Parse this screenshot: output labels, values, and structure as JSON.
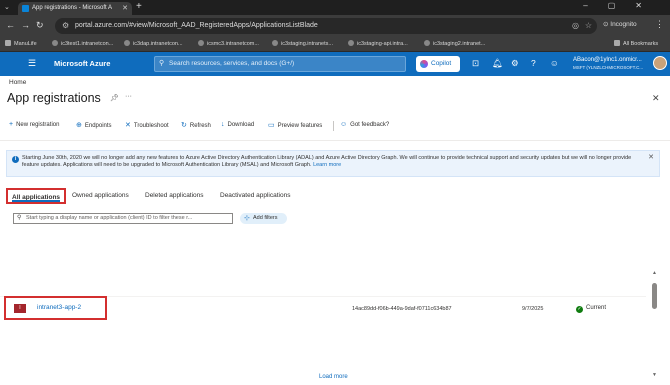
{
  "browser": {
    "tab_title": "App registrations - Microsoft A",
    "url": "portal.azure.com/#view/Microsoft_AAD_RegisteredApps/ApplicationsListBlade",
    "profile_label": "Incognito",
    "bookmarks": [
      "ManuLife",
      "ic3test1.intranetcon...",
      "ic3dap.intranetcon...",
      "icsmc3.intranetcom...",
      "ic3staging.intranets...",
      "ic3staging-api.intra...",
      "ic3staging2.intranet..."
    ],
    "all_bookmarks_label": "All Bookmarks"
  },
  "azure_header": {
    "brand": "Microsoft Azure",
    "search_placeholder": "Search resources, services, and docs (G+/)",
    "copilot_label": "Copilot",
    "user_email": "ABacon@1ylnc1.onmicr...",
    "user_tenant": "MSFT (YLNZLCHMICROSOFT.C..."
  },
  "page": {
    "breadcrumb": "Home",
    "title": "App registrations"
  },
  "toolbar": {
    "new_registration": "New registration",
    "endpoints": "Endpoints",
    "troubleshoot": "Troubleshoot",
    "refresh": "Refresh",
    "download": "Download",
    "preview_features": "Preview features",
    "got_feedback": "Got feedback?"
  },
  "info_banner": {
    "text": "Starting June 30th, 2020 we will no longer add any new features to Azure Active Directory Authentication Library (ADAL) and Azure Active Directory Graph. We will continue to provide technical support and security updates but we will no longer provide feature updates. Applications will need to be upgraded to Microsoft Authentication Library (MSAL) and Microsoft Graph.",
    "link": "Learn more"
  },
  "tabs": [
    "All applications",
    "Owned applications",
    "Deleted applications",
    "Deactivated applications"
  ],
  "filter": {
    "placeholder": "Start typing a display name or application (client) ID to filter these r...",
    "add_filters": "Add filters"
  },
  "apps": [
    {
      "icon_text": "I",
      "name": "intranet3-app-2",
      "client_id": "14ac89dd-f06b-449a-9daf-f0711c634b87",
      "created": "9/7/2025",
      "status": "Current"
    }
  ],
  "load_more": "Load more",
  "colors": {
    "azure_blue": "#0f6cbd",
    "highlight_red": "#d32f2f",
    "app_icon": "#a4262c",
    "status_ok": "#107c10"
  }
}
